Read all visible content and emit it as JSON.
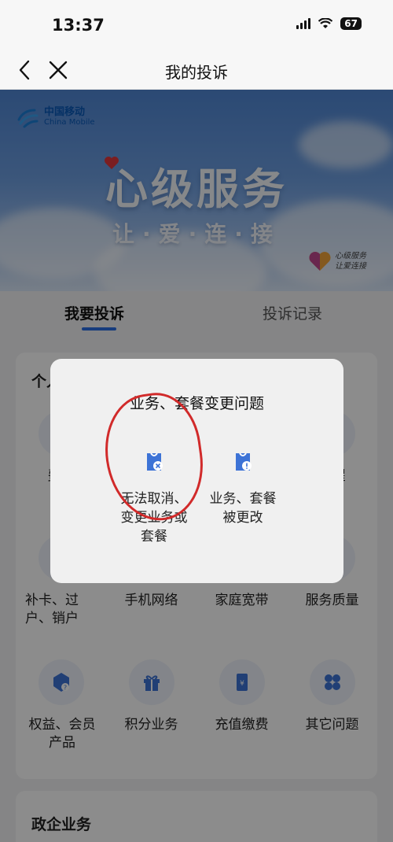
{
  "status": {
    "time": "13:37",
    "battery": "67"
  },
  "nav": {
    "title": "我的投诉"
  },
  "banner": {
    "brand_cn": "中国移动",
    "brand_en": "China Mobile",
    "title": "心级服务",
    "slogan": "让·爱·连·接",
    "mini_logo_line1": "心级服务",
    "mini_logo_line2": "让爱连接"
  },
  "tabs": {
    "active": "我要投诉",
    "inactive": "投诉记录"
  },
  "card": {
    "title": "个人业务",
    "items": [
      {
        "label": "费用",
        "icon": "fee-icon"
      },
      {
        "label": "",
        "icon": "package-icon"
      },
      {
        "label": "",
        "icon": "business-icon"
      },
      {
        "label": "提醒",
        "icon": "reminder-icon"
      },
      {
        "label": "补卡、过户、销户",
        "icon": "sim-card-icon"
      },
      {
        "label": "手机网络",
        "icon": "mobile-network-icon"
      },
      {
        "label": "家庭宽带",
        "icon": "home-broadband-icon"
      },
      {
        "label": "服务质量",
        "icon": "service-quality-icon"
      },
      {
        "label": "权益、会员产品",
        "icon": "member-benefits-icon"
      },
      {
        "label": "积分业务",
        "icon": "gift-points-icon"
      },
      {
        "label": "充值缴费",
        "icon": "recharge-icon"
      },
      {
        "label": "其它问题",
        "icon": "other-grid-icon"
      }
    ]
  },
  "card2": {
    "title": "政企业务"
  },
  "modal": {
    "title": "业务、套餐变更问题",
    "options": [
      {
        "label": "无法取消、\n变更业务或\n套餐",
        "icon": "cancel-change-icon"
      },
      {
        "label": "业务、套餐\n被更改",
        "icon": "changed-warning-icon"
      }
    ]
  },
  "colors": {
    "accent": "#2b6de3",
    "annotation": "#d12a2a",
    "icon_blue": "#3d73d6"
  }
}
